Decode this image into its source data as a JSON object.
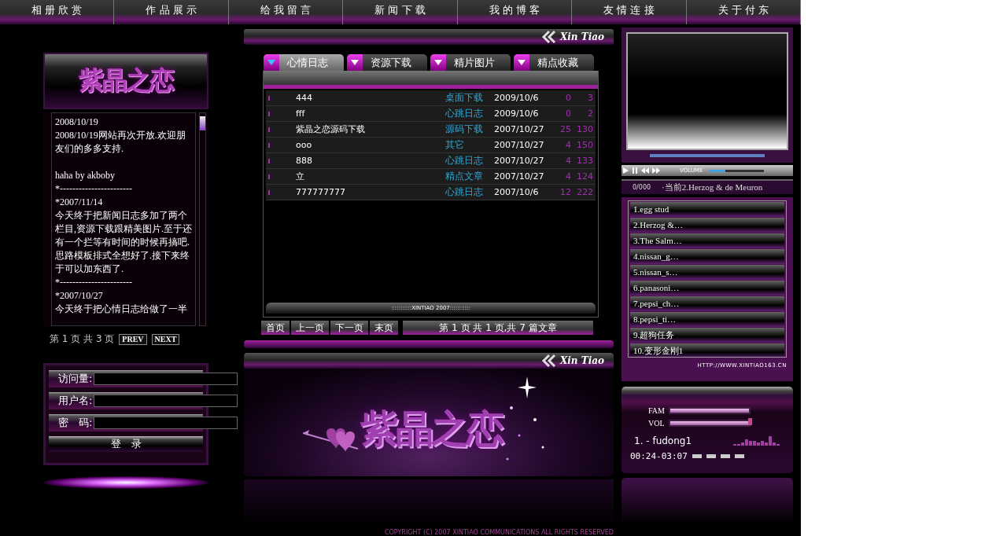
{
  "nav": [
    "相 册 欣 赏",
    "作 品 展 示",
    "给 我 留 言",
    "新 闻 下 载",
    "我 的 博 客",
    "友 情 连 接",
    "关 于 付 东"
  ],
  "left": {
    "logo": "紫晶之恋",
    "news_blocks": [
      [
        "2008/10/19",
        "2008/10/19网站再次开放.欢迎朋友们的多多支持."
      ],
      [
        "haha  by  akboby",
        "*-----------------------",
        "*2007/11/14",
        "今天终于把新闻日志多加了两个栏目,资源下载跟精美图片.至于还有一个拦等有时间的时候再搞吧.思路模板排式全想好了.接下来终于可以加东西了.",
        "*-----------------------",
        "*2007/10/27",
        "今天终于把心情日志给做了一半"
      ]
    ],
    "pager": "第 1 页 共 3 页",
    "prev": "PREV",
    "next": "NEXT",
    "login": [
      {
        "label": "访问量:"
      },
      {
        "label": "用户名:"
      },
      {
        "label": "密　码:"
      }
    ],
    "login_button": "登　录"
  },
  "center": {
    "brand": "Xin Tiao",
    "tabs": [
      {
        "label": "心情日志",
        "selected": true
      },
      {
        "label": "资源下载",
        "selected": false
      },
      {
        "label": "精片图片",
        "selected": false
      },
      {
        "label": "精点收藏",
        "selected": false
      }
    ],
    "rows": [
      {
        "title": "444",
        "category": "桌面下载",
        "date": "2009/10/6",
        "count_1": "0",
        "count_2": "3"
      },
      {
        "title": "fff",
        "category": "心跳日志",
        "date": "2009/10/6",
        "count_1": "0",
        "count_2": "2"
      },
      {
        "title": "紫晶之恋源码下载",
        "category": "源码下载",
        "date": "2007/10/27",
        "count_1": "25",
        "count_2": "130"
      },
      {
        "title": "ooo",
        "category": "其它",
        "date": "2007/10/27",
        "count_1": "4",
        "count_2": "150"
      },
      {
        "title": "888",
        "category": "心跳日志",
        "date": "2007/10/27",
        "count_1": "4",
        "count_2": "133"
      },
      {
        "title": "立",
        "category": "精点文章",
        "date": "2007/10/27",
        "count_1": "4",
        "count_2": "124"
      },
      {
        "title": "777777777",
        "category": "心跳日志",
        "date": "2007/10/6",
        "count_1": "12",
        "count_2": "222"
      }
    ],
    "table_footer": ":::::::::::XINTIAO 2007:::::::::::",
    "pager_buttons": [
      "首页",
      "上一页",
      "下一页",
      "末页"
    ],
    "pager_info": "第 1 页  共 1 页,共 7 篇文章",
    "brand_2": "Xin Tiao",
    "banner_logo": "紫晶之恋",
    "copyright": "COPYRIGHT (C) 2007 XINTIAO COMMUNICATIONS ALL RIGHTS RESERVED"
  },
  "right": {
    "volume_label": "VOLUME",
    "volume": {
      "level": 0.3
    },
    "counter": "0/000",
    "now_playing": "·当前2.Herzog & de Meuron",
    "playlist": [
      "1.egg stud",
      "2.Herzog &…",
      "3.The Salm…",
      "4.nissan_g…",
      "5.nissan_s…",
      "6.panasoni…",
      "7.pepsi_ch…",
      "8.pepsi_ti…",
      "9.超狗任务",
      "10.变形金刚1"
    ],
    "url": "HTTP://WWW.XINTIAO163.CN",
    "radio": {
      "fam_label": "FAM",
      "fam": {
        "level": 1
      },
      "vol_label": "VOL",
      "vol": {
        "level": 1
      },
      "track": "1. - fudong1",
      "time": "00:24-03:07"
    }
  }
}
